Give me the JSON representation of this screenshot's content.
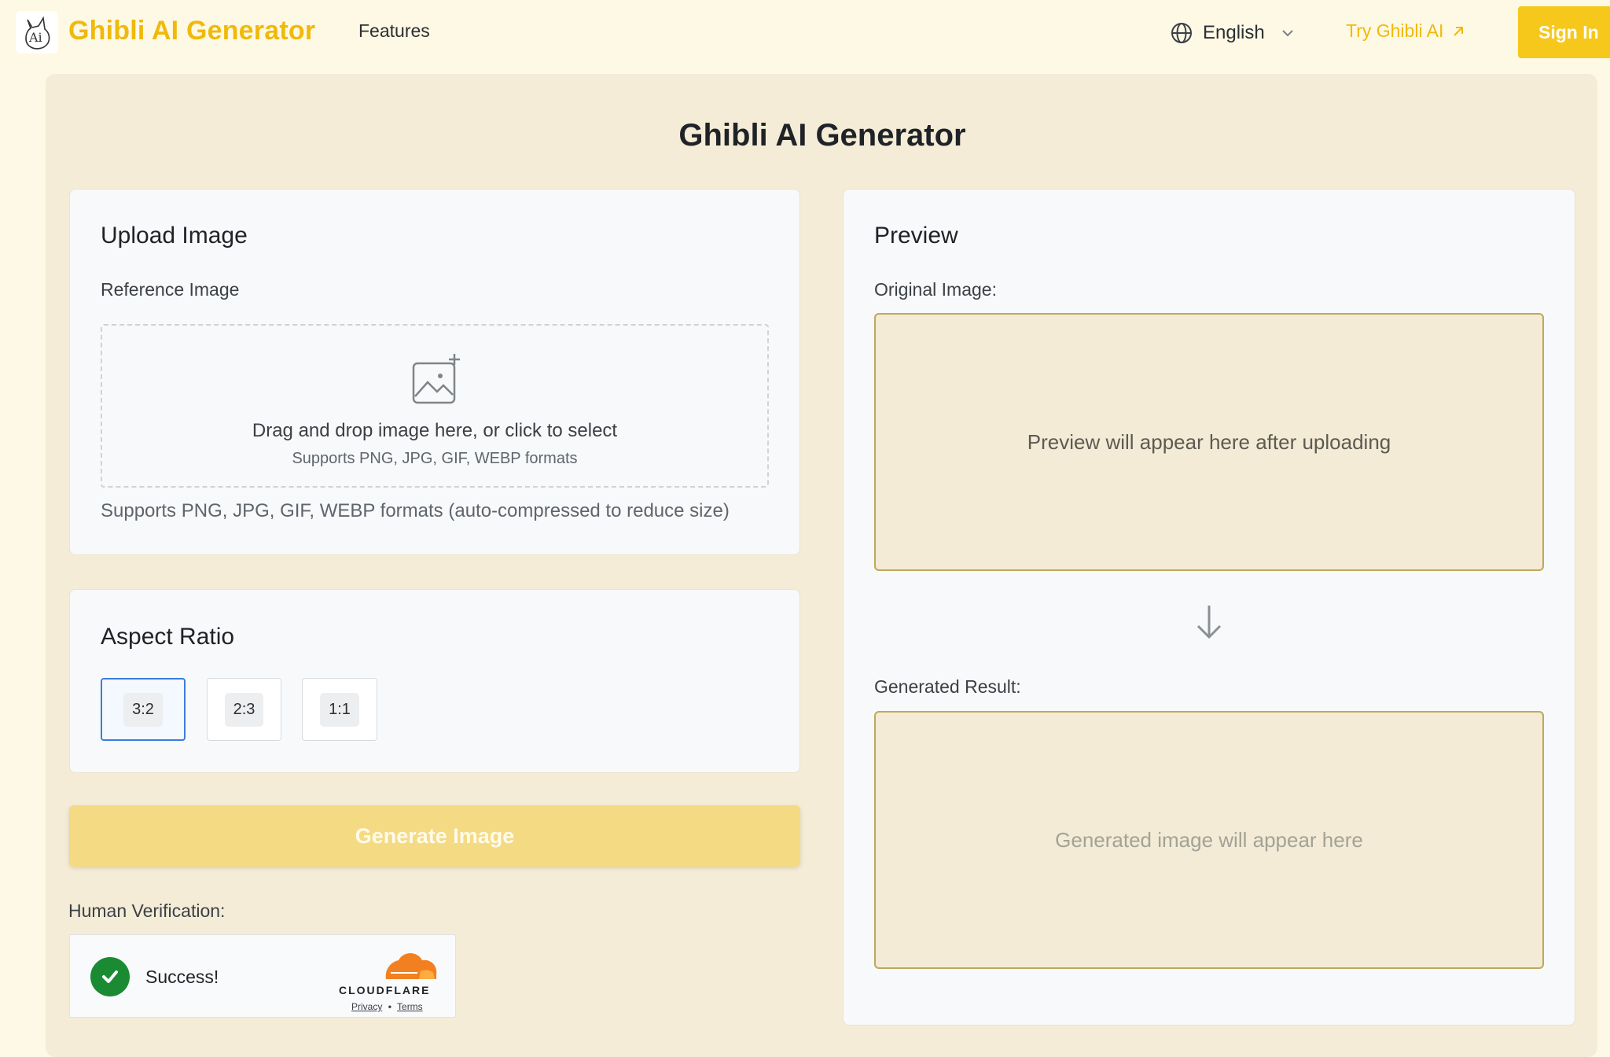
{
  "header": {
    "brand": "Ghibli AI Generator",
    "nav_features": "Features",
    "language": "English",
    "try_link": "Try Ghibli AI",
    "sign_in": "Sign In"
  },
  "page_title": "Ghibli AI Generator",
  "upload": {
    "title": "Upload Image",
    "label": "Reference Image",
    "drop_main": "Drag and drop image here, or click to select",
    "drop_sub": "Supports PNG, JPG, GIF, WEBP formats",
    "note": "Supports PNG, JPG, GIF, WEBP formats (auto-compressed to reduce size)"
  },
  "aspect": {
    "title": "Aspect Ratio",
    "options": [
      "3:2",
      "2:3",
      "1:1"
    ],
    "selected": "3:2"
  },
  "generate_button": "Generate Image",
  "verification": {
    "label": "Human Verification:",
    "status": "Success!",
    "provider": "CLOUDFLARE",
    "privacy": "Privacy",
    "separator": "•",
    "terms": "Terms"
  },
  "preview": {
    "title": "Preview",
    "original_label": "Original Image:",
    "original_placeholder": "Preview will appear here after uploading",
    "result_label": "Generated Result:",
    "result_placeholder": "Generated image will appear here"
  },
  "colors": {
    "accent": "#f0b90b",
    "sign_in_bg": "#f6c81c",
    "generate_bg": "#f4da83",
    "success": "#1a8a33",
    "cloudflare": "#f38020"
  }
}
